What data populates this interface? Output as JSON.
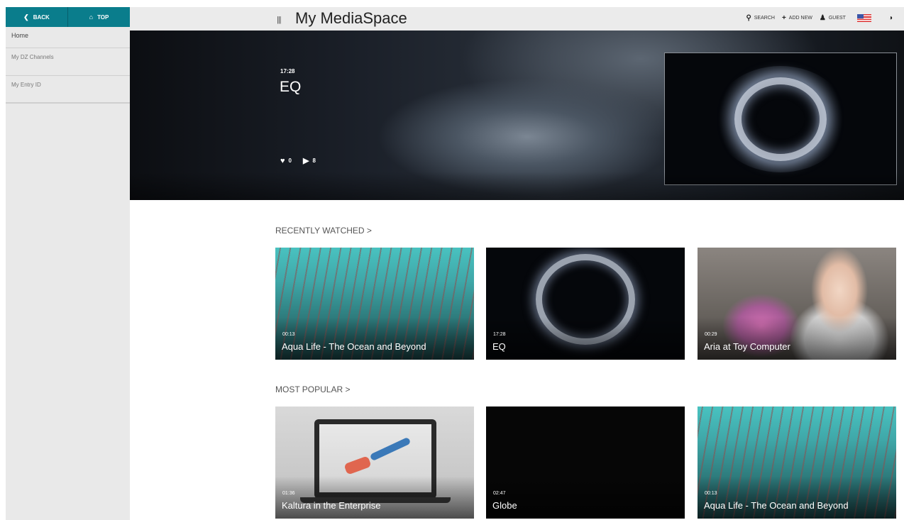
{
  "sidebar": {
    "back_label": "BACK",
    "top_label": "TOP",
    "items": [
      {
        "label": "Home"
      },
      {
        "label": "My DZ Channels"
      },
      {
        "label": "My Entry ID"
      }
    ]
  },
  "header": {
    "title": "My MediaSpace",
    "search_label": "SEARCH",
    "add_new_label": "ADD NEW",
    "guest_label": "GUEST"
  },
  "hero": {
    "duration": "17:28",
    "title": "EQ",
    "likes": "0",
    "plays": "8"
  },
  "recently_watched": {
    "title": "RECENTLY WATCHED >",
    "items": [
      {
        "duration": "00:13",
        "title": "Aqua Life - The Ocean and Beyond"
      },
      {
        "duration": "17:28",
        "title": "EQ"
      },
      {
        "duration": "00:29",
        "title": "Aria at Toy Computer"
      }
    ]
  },
  "most_popular": {
    "title": "MOST POPULAR >",
    "items": [
      {
        "duration": "01:36",
        "title": "Kaltura in the Enterprise"
      },
      {
        "duration": "02:47",
        "title": "Globe"
      },
      {
        "duration": "00:13",
        "title": "Aqua Life - The Ocean and Beyond"
      }
    ]
  },
  "colors": {
    "accent": "#0a7d8c",
    "sidebar_bg": "#e9e9e9",
    "header_bg": "#ebebeb"
  },
  "icons": {
    "back": "chevron-left-icon",
    "top": "home-icon",
    "menu": "hamburger-icon",
    "search": "search-icon",
    "add": "plus-icon",
    "user": "user-icon",
    "language": "us-flag-icon",
    "contrast": "contrast-icon",
    "like": "heart-icon",
    "play": "play-icon"
  }
}
